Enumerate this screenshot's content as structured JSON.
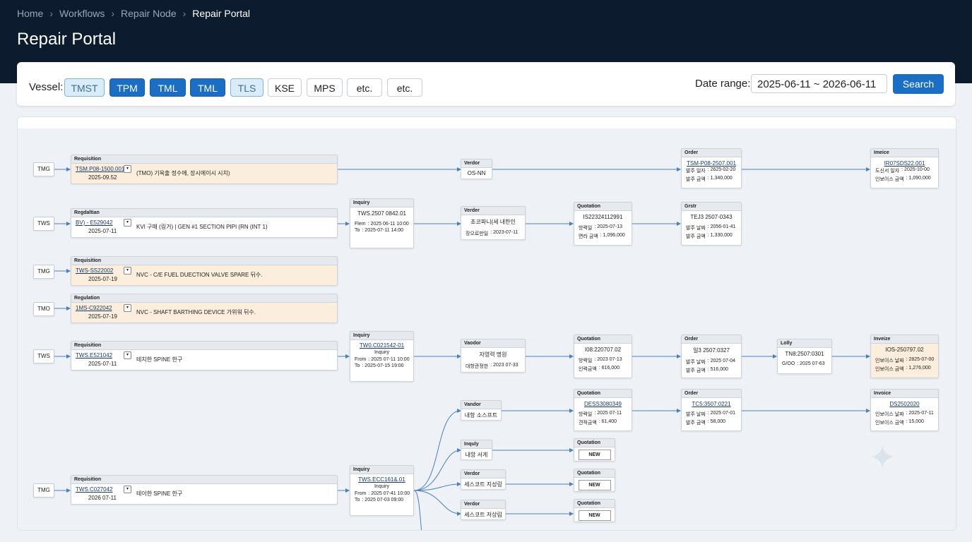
{
  "breadcrumb": [
    "Home",
    "Workflows",
    "Repair Node",
    "Repair Portal"
  ],
  "page_title": "Repair Portal",
  "filter": {
    "vessel_label": "Vessel:",
    "vessels": [
      {
        "label": "TMST",
        "state": "soft"
      },
      {
        "label": "TPM",
        "state": "on"
      },
      {
        "label": "TML",
        "state": "on"
      },
      {
        "label": "TML",
        "state": "on"
      },
      {
        "label": "TLS",
        "state": "soft"
      },
      {
        "label": "KSE",
        "state": "off"
      },
      {
        "label": "MPS",
        "state": "off"
      },
      {
        "label": "etc.",
        "state": "off"
      },
      {
        "label": "etc.",
        "state": "off"
      }
    ],
    "date_label": "Date range:",
    "date_value": "2025-06-11 ~ 2026-06-11",
    "search_label": "Search"
  },
  "rows": [
    {
      "ship": "TMG",
      "req": {
        "title": "Requisition",
        "ref": "TSM.P08-1500.001",
        "date": "2025-09.52",
        "desc": "(TMO) 기욕출 정수에, 장시에이시 시치)",
        "warm": true
      },
      "vendor": {
        "title": "Verdor",
        "name": "OS-NN"
      },
      "order": {
        "title": "Order",
        "ref": "TSM-P08-2507.001",
        "r1l": "발주 일자",
        "r1v": ": 2625-02-20",
        "r2l": "발주 금액",
        "r2v": ": 1,340,000"
      },
      "invoice": {
        "title": "Imeice",
        "ref": "IR07SDS22.001",
        "r1l": "도신서 일자",
        "r1v": ": 2025-10-00",
        "r2l": "인보이스 금액",
        "r2v": ": 1,090,000"
      }
    },
    {
      "ship": "TWS",
      "req": {
        "title": "Regdaltian",
        "ref": "BV) - E529042",
        "date": "2025-07-11",
        "desc": "KVI 구매 (링거) | GEN #1 SECTION PIPI (RN (INT 1)",
        "warm": false
      },
      "inquiry": {
        "title": "Inquiry",
        "ref": "TWS.2507 0842.01",
        "r1l": "Flem",
        "r1v": ": 2025 06-11 10:00",
        "r2l": "To",
        "r2v": ": 2025-07-11 14:00"
      },
      "vendor": {
        "title": "Verder",
        "name": "초코파니(세 내한인",
        "sub": "장으로만일",
        "subv": ": 2023-07-11"
      },
      "quotation": {
        "title": "Quotation",
        "ref": "IS22324112991",
        "r1l": "방력일",
        "r1v": ": 2025-07-13",
        "r2l": "면라 금액",
        "r2v": ": 1,096,000"
      },
      "order": {
        "title": "Grstr",
        "ref": "TEJ3 2507-0343",
        "r1l": "발주 날짜",
        "r1v": ": 2056-01-41",
        "r2l": "발주 금액",
        "r2v": ": 1,330,000"
      }
    },
    {
      "ship": "TMG",
      "req": {
        "title": "Requisition",
        "ref": "TWS-SS22002",
        "date": "2025-07-19",
        "desc": "NVC - C/E FUEL DUECTION VALVE SPARE 뒤수.",
        "warm": true
      }
    },
    {
      "ship": "TMO",
      "req": {
        "title": "Regulation",
        "ref": "1MS-C922042",
        "date": "2025-07-19",
        "desc": "NVC - SHAFT BARTHING DEVICE 가위워 뒤수.",
        "warm": true
      }
    },
    {
      "ship": "TWS",
      "req": {
        "title": "Requisition",
        "ref": "TWS.E521042",
        "date": "2025-07-11",
        "desc": "테치한 SPINE 한구",
        "warm": false
      },
      "inquiry": {
        "title": "Inquiry",
        "ref": "TW0.C021542-01",
        "mid": "Inquiry",
        "r1l": "From",
        "r1v": ": 2025 07-11 10:00",
        "r2l": "To",
        "r2v": ": 2025-07-15 19:00"
      },
      "vendor": {
        "title": "Vaodor",
        "name": "자영력 명원",
        "sub": "대항관정한",
        "subv": ": 2023 07-33"
      },
      "quotation": {
        "title": "Quotation",
        "ref": "I08:220707.02",
        "r1l": "방력일",
        "r1v": ": 2023 07-13",
        "r2l": "인력금액",
        "r2v": ": 616,000"
      },
      "order": {
        "title": "Order",
        "ref": "일3 2507:0327",
        "r1l": "발주 날짜",
        "r1v": ": 2025 07-04",
        "r2l": "발주 금액",
        "r2v": ": 516,000"
      },
      "delivery": {
        "title": "Lolly",
        "ref": "TN8:2507:0301",
        "r1l": "G/OO",
        "r1v": ": 2025 07-63"
      },
      "invoice": {
        "title": "Inveize",
        "ref": "IOS-250797.02",
        "r1l": "인보이스 날짜",
        "r1v": ": 2825-07-00",
        "r2l": "인보이스 금액",
        "r2v": ": 1,276,000",
        "warm": true
      }
    },
    {
      "ship": "TMG",
      "req": {
        "title": "Requisition",
        "ref": "TWS.C027042",
        "date": "2026 07-11",
        "desc": "테이한 SPINE 한구",
        "warm": false
      },
      "inquiry": {
        "title": "Inquiry",
        "ref": "TWS.ECC161&.01",
        "mid": "Inquiry",
        "r1l": "From",
        "r1v": ": 2025 07-41 10:00",
        "r2l": "To",
        "r2v": ": 2025 07-03 09:00"
      },
      "branches": [
        {
          "vendor": {
            "title": "Vandor",
            "name": "내항 소스프트"
          },
          "quotation": {
            "title": "Quotation",
            "ref": "DESS3080349",
            "r1l": "방력일",
            "r1v": ": 2025 07-11",
            "r2l": "견적금액",
            "r2v": ": 61,400"
          },
          "order": {
            "title": "Order",
            "ref": "TC5:3507:0221",
            "r1l": "발주 날짜",
            "r1v": ": 2025 07-01",
            "r2l": "발주 금액",
            "r2v": ": 58,000"
          },
          "invoice": {
            "title": "Invoice",
            "ref": "DS2502020",
            "r1l": "인보이스 날짜",
            "r1v": ": 2025-07-11",
            "r2l": "인보이스 금액",
            "r2v": ": 15,000"
          }
        },
        {
          "vendor": {
            "title": "Inquly",
            "name": "내앙 서게"
          },
          "quotation": {
            "title": "Quotation",
            "badge": "NEW"
          }
        },
        {
          "vendor": {
            "title": "Verdor",
            "name": "세스코트 지성링"
          },
          "quotation": {
            "title": "Quotation",
            "badge": "NEW"
          }
        },
        {
          "vendor": {
            "title": "Verdor",
            "name": "세스코트 저상림"
          },
          "quotation": {
            "title": "Quotation",
            "badge": "NEW"
          }
        }
      ]
    }
  ],
  "colors": {
    "accent": "#1a6fc4",
    "header": "#0d1b2e",
    "warm": "#fbeedd",
    "line": "#4a7fc0"
  }
}
